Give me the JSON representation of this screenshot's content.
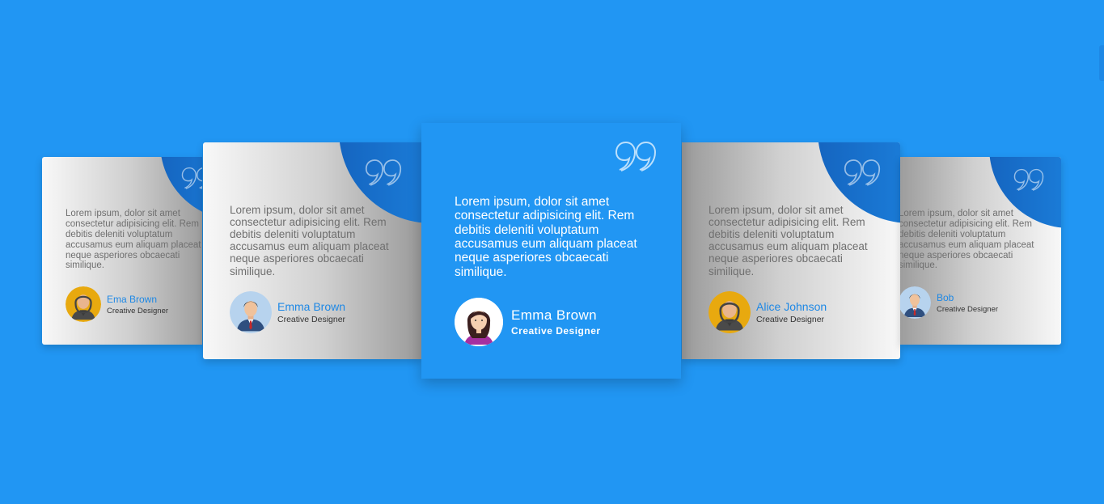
{
  "colors": {
    "background": "#2196f3",
    "accent": "#1e88e5"
  },
  "cards": [
    {
      "text": "Lorem ipsum, dolor sit amet consectetur adipisicing elit. Rem debitis deleniti voluptatum accusamus eum aliquam placeat neque asperiores obcaecati similique.",
      "name": "Ema Brown",
      "role": "Creative Designer",
      "avatar_icon": "man-hoodie-avatar-icon"
    },
    {
      "text": "Lorem ipsum, dolor sit amet consectetur adipisicing elit. Rem debitis deleniti voluptatum accusamus eum aliquam placeat neque asperiores obcaecati similique.",
      "name": "Emma Brown",
      "role": "Creative Designer",
      "avatar_icon": "man-suit-avatar-icon"
    },
    {
      "text": "Lorem ipsum, dolor sit amet consectetur adipisicing elit. Rem debitis deleniti voluptatum accusamus eum aliquam placeat neque asperiores obcaecati similique.",
      "name": "Emma Brown",
      "role": "Creative Designer",
      "avatar_icon": "woman-avatar-icon"
    },
    {
      "text": "Lorem ipsum, dolor sit amet consectetur adipisicing elit. Rem debitis deleniti voluptatum accusamus eum aliquam placeat neque asperiores obcaecati similique.",
      "name": "Alice Johnson",
      "role": "Creative Designer",
      "avatar_icon": "man-hoodie-avatar-icon"
    },
    {
      "text": "Lorem ipsum, dolor sit amet consectetur adipisicing elit. Rem debitis deleniti voluptatum accusamus eum aliquam placeat neque asperiores obcaecati similique.",
      "name": "Bob",
      "role": "Creative Designer",
      "avatar_icon": "man-suit-avatar-icon"
    }
  ]
}
